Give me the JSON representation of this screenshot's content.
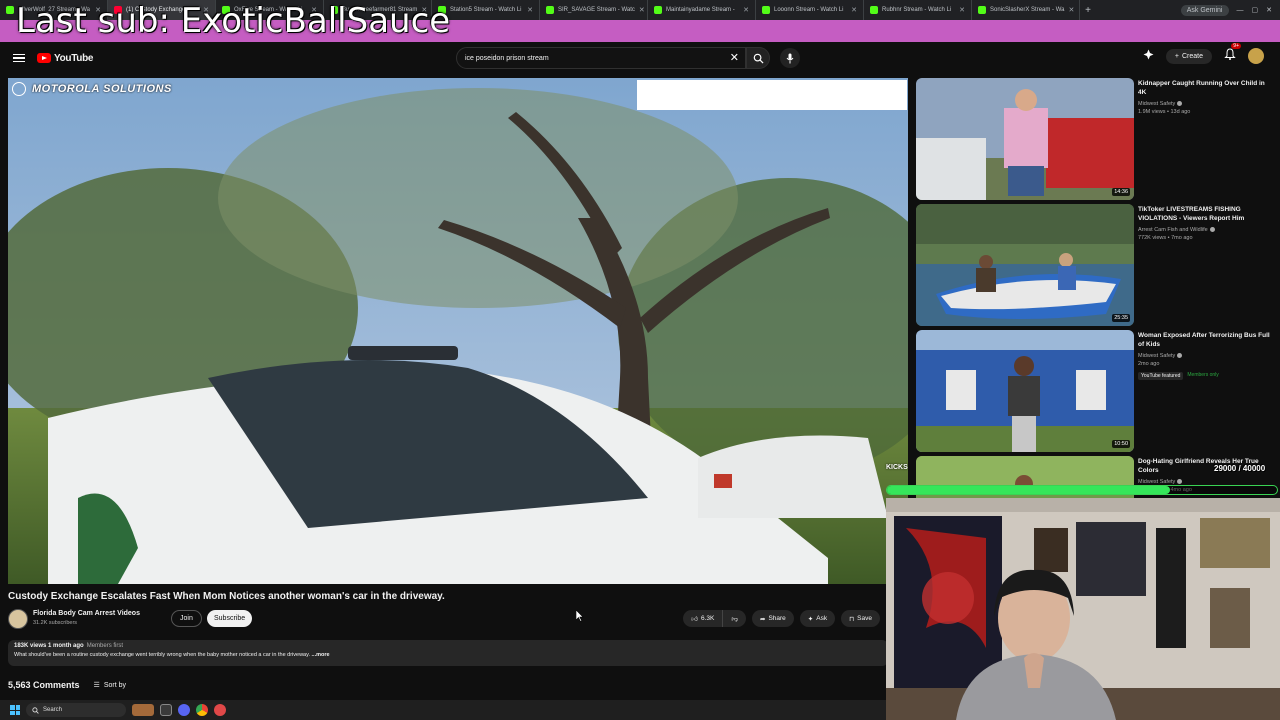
{
  "overlay": {
    "title": "Last sub: ExoticBallSauce",
    "kicks_label": "KICKS",
    "goal_progress_text": "29000 / 40000",
    "goal_fraction": 0.725
  },
  "browser": {
    "tabs": [
      {
        "label": "SilverWolf_27 Stream - Wa",
        "active": false
      },
      {
        "label": "(1) Custody Exchange E",
        "active": true
      },
      {
        "label": "OxFive Stream - Watch Li",
        "active": false
      },
      {
        "label": "Bumblebeefarmer81 Stream",
        "active": false
      },
      {
        "label": "Station5 Stream - Watch Li",
        "active": false
      },
      {
        "label": "SIR_SAVAGE Stream - Watc",
        "active": false
      },
      {
        "label": "Maintainyadame Stream -",
        "active": false
      },
      {
        "label": "Looonn Stream - Watch Li",
        "active": false
      },
      {
        "label": "Rubhnr Stream - Watch Li",
        "active": false
      },
      {
        "label": "SonicSlasherX Stream - Wa",
        "active": false
      }
    ],
    "ask_gemini": "Ask Gemini"
  },
  "header": {
    "logo_text": "YouTube",
    "search_value": "ice poseidon prison stream",
    "create_label": "Create",
    "notification_count": "9+"
  },
  "player": {
    "watermark": "MOTOROLA SOLUTIONS"
  },
  "video": {
    "title": "Custody Exchange Escalates Fast When Mom Notices another woman's car in the driveway.",
    "channel_name": "Florida Body Cam Arrest Videos",
    "subscribers": "31.2K subscribers",
    "join_label": "Join",
    "subscribe_label": "Subscribe",
    "likes": "6.3K",
    "share_label": "Share",
    "ask_label": "Ask",
    "save_label": "Save",
    "views_age": "183K views  1 month ago",
    "members_first": "Members first",
    "description": "What should've been a routine custody exchange went terribly wrong when the baby mother noticed a car in the driveway.",
    "more_label": "...more",
    "comments_count": "5,563 Comments",
    "sort_label": "Sort by"
  },
  "recommendations": [
    {
      "title": "Kidnapper Caught Running Over Child in 4K",
      "channel": "Midwest Safety",
      "meta": "1.9M views • 13d ago",
      "duration": "14:36"
    },
    {
      "title": "TikToker LIVESTREAMS FISHING VIOLATIONS - Viewers Report Him",
      "channel": "Arrest Cam Fish and Wildlife",
      "meta": "772K views • 7mo ago",
      "duration": "25:35"
    },
    {
      "title": "Woman Exposed After Terrorizing Bus Full of Kids",
      "channel": "Midwest Safety",
      "meta": "2mo ago",
      "duration": "10:50",
      "badge_featured": "YouTube featured",
      "badge_members": "Members only"
    },
    {
      "title": "Dog-Hating Girlfriend Reveals Her True Colors",
      "channel": "Midwest Safety",
      "meta": "1.5M views • 4mo ago",
      "duration": ""
    }
  ],
  "taskbar": {
    "search_label": "Search"
  },
  "colors": {
    "accent_red": "#ff0000",
    "overlay_band": "#d966d6",
    "goal_green": "#35e65a"
  }
}
